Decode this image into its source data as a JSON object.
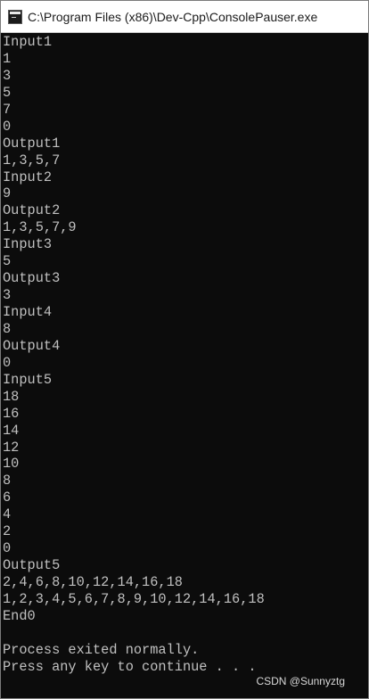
{
  "window": {
    "title": "C:\\Program Files (x86)\\Dev-Cpp\\ConsolePauser.exe",
    "icon": "console-app-icon"
  },
  "console": {
    "lines": [
      "Input1",
      "1",
      "3",
      "5",
      "7",
      "0",
      "Output1",
      "1,3,5,7",
      "Input2",
      "9",
      "Output2",
      "1,3,5,7,9",
      "Input3",
      "5",
      "Output3",
      "3",
      "Input4",
      "8",
      "Output4",
      "0",
      "Input5",
      "18",
      "16",
      "14",
      "12",
      "10",
      "8",
      "6",
      "4",
      "2",
      "0",
      "Output5",
      "2,4,6,8,10,12,14,16,18",
      "1,2,3,4,5,6,7,8,9,10,12,14,16,18",
      "End0",
      "",
      "Process exited normally.",
      "Press any key to continue . . ."
    ]
  },
  "watermark": {
    "text": "CSDN @Sunnyztg"
  }
}
